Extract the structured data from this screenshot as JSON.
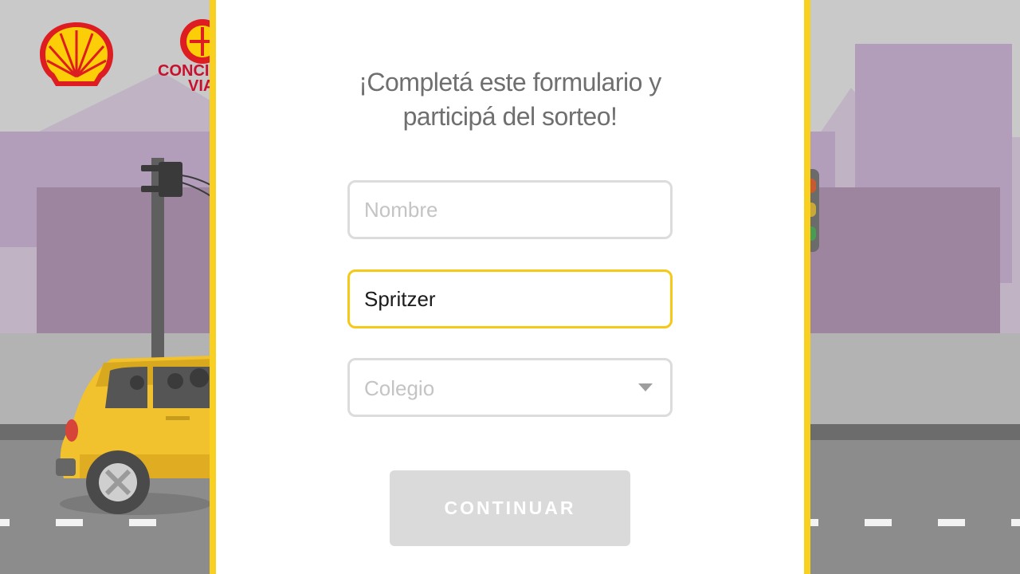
{
  "form": {
    "title_line1": "¡Completá este formulario y",
    "title_line2": "participá del sorteo!",
    "nombre_placeholder": "Nombre",
    "apellido_value": "Spritzer",
    "colegio_placeholder": "Colegio",
    "continue_label": "CONTINUAR"
  },
  "logo": {
    "cv_text_line1": "CONCIENCIA",
    "cv_text_line2": "VIAL"
  },
  "icons": {
    "brand_logo": "shell-logo-icon",
    "campaign_logo": "conciencia-vial-logo-icon",
    "dropdown": "caret-down-icon"
  },
  "colors": {
    "accent": "#f9d01f",
    "active_border": "#f5c918",
    "button_disabled": "#dadada",
    "field_border": "#dcdcdc"
  }
}
